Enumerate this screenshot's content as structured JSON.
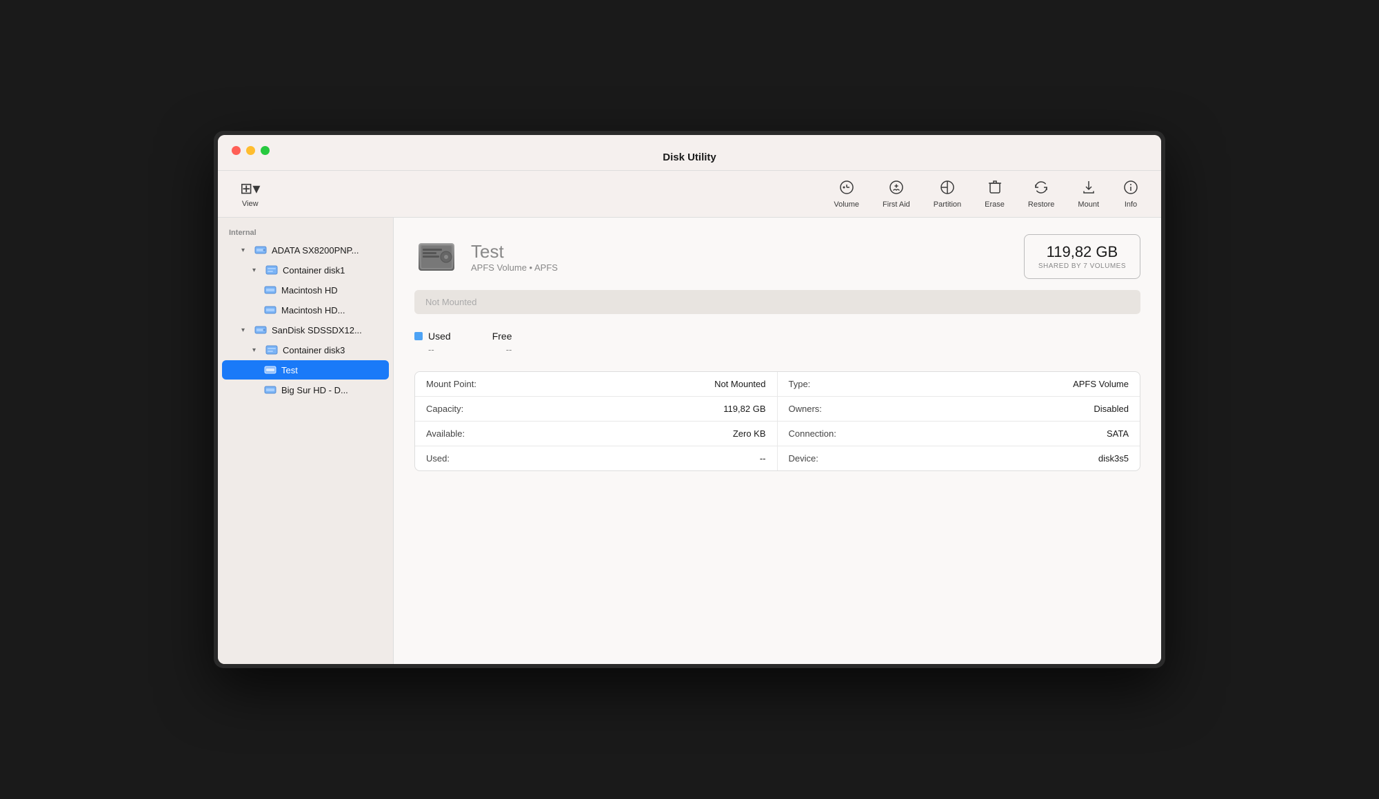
{
  "window": {
    "title": "Disk Utility"
  },
  "toolbar": {
    "view_label": "View",
    "volume_label": "Volume",
    "first_aid_label": "First Aid",
    "partition_label": "Partition",
    "erase_label": "Erase",
    "restore_label": "Restore",
    "mount_label": "Mount",
    "info_label": "Info"
  },
  "sidebar": {
    "section_label": "Internal",
    "items": [
      {
        "id": "adata",
        "label": "ADATA SX8200PNP...",
        "level": 1,
        "type": "drive",
        "expanded": true
      },
      {
        "id": "container1",
        "label": "Container disk1",
        "level": 2,
        "type": "container",
        "expanded": true
      },
      {
        "id": "macintosh-hd",
        "label": "Macintosh HD",
        "level": 3,
        "type": "volume"
      },
      {
        "id": "macintosh-hd2",
        "label": "Macintosh HD...",
        "level": 3,
        "type": "volume"
      },
      {
        "id": "sandisk",
        "label": "SanDisk SDSSDX12...",
        "level": 1,
        "type": "drive",
        "expanded": true
      },
      {
        "id": "container3",
        "label": "Container disk3",
        "level": 2,
        "type": "container",
        "expanded": true
      },
      {
        "id": "test",
        "label": "Test",
        "level": 3,
        "type": "volume",
        "selected": true
      },
      {
        "id": "bigsur",
        "label": "Big Sur HD - D...",
        "level": 3,
        "type": "volume"
      }
    ]
  },
  "content": {
    "disk_name": "Test",
    "disk_subtitle": "APFS Volume • APFS",
    "disk_size": "119,82 GB",
    "disk_size_label": "SHARED BY 7 VOLUMES",
    "not_mounted_label": "Not Mounted",
    "used_label": "Used",
    "used_value": "--",
    "free_label": "Free",
    "free_value": "--",
    "info_rows": [
      {
        "key": "Mount Point:",
        "value": "Not Mounted",
        "key2": "Type:",
        "value2": "APFS Volume"
      },
      {
        "key": "Capacity:",
        "value": "119,82 GB",
        "key2": "Owners:",
        "value2": "Disabled"
      },
      {
        "key": "Available:",
        "value": "Zero KB",
        "key2": "Connection:",
        "value2": "SATA"
      },
      {
        "key": "Used:",
        "value": "--",
        "key2": "Device:",
        "value2": "disk3s5"
      }
    ]
  }
}
